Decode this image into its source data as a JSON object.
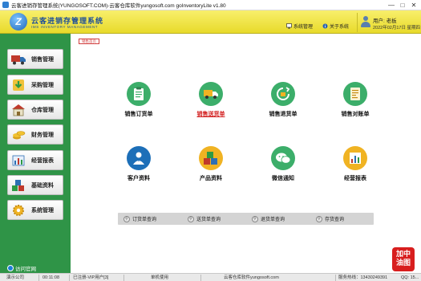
{
  "window": {
    "title": "云客进销存管理系统(YUNGOSOFT.COM)-云客仓库软件yungosoft.com  goInventoryLite v1.80"
  },
  "header": {
    "logo_letter": "Z",
    "logo_cn": "云客进销存管理系统",
    "logo_en": "IMS INVENTORY MANAGEMENT",
    "sys_mgmt": "系统管理",
    "about": "关于系统",
    "user_label": "用户: 老板",
    "datetime": "2022年02月17日 星期四"
  },
  "sidebar": {
    "items": [
      {
        "label": "销售管理",
        "icon": "truck-icon"
      },
      {
        "label": "采购管理",
        "icon": "download-arrow-icon"
      },
      {
        "label": "仓库管理",
        "icon": "warehouse-icon"
      },
      {
        "label": "财务管理",
        "icon": "coins-icon"
      },
      {
        "label": "经营报表",
        "icon": "report-icon"
      },
      {
        "label": "基础资料",
        "icon": "cubes-icon"
      },
      {
        "label": "系统管理",
        "icon": "gear-icon"
      }
    ],
    "visit_site": "访问官网"
  },
  "main": {
    "tab": "销售首页",
    "tiles": [
      {
        "label": "销售订货单",
        "icon": "clipboard-icon",
        "color": "#3cae6a"
      },
      {
        "label": "销售送货单",
        "icon": "delivery-truck-icon",
        "color": "#3cae6a",
        "active": true
      },
      {
        "label": "销售退货单",
        "icon": "return-box-icon",
        "color": "#3cae6a"
      },
      {
        "label": "销售对账单",
        "icon": "statement-icon",
        "color": "#3cae6a"
      },
      {
        "label": "客户资料",
        "icon": "customer-icon",
        "color": "#1d6fb8"
      },
      {
        "label": "产品资料",
        "icon": "product-boxes-icon",
        "color": "#f0b323"
      },
      {
        "label": "微信通知",
        "icon": "wechat-icon",
        "color": "#3cae6a"
      },
      {
        "label": "经营报表",
        "icon": "chart-report-icon",
        "color": "#f0b323"
      }
    ],
    "queries": [
      "订货单查询",
      "送货单查询",
      "退货单查询",
      "存货查询"
    ]
  },
  "status": {
    "company": "演示公司",
    "time": "00:11:08",
    "register": "已注册-VIP用户[3]",
    "mode": "单机使用",
    "product": "云客仓库软件yungosoft.com",
    "service": "服务热线：13430249391",
    "qq": "QQ: 15..."
  },
  "badge": {
    "line1": "加中",
    "line2": "油图"
  },
  "colors": {
    "sidebar": "#2f9447",
    "header": "#f3e84c",
    "accent_red": "#d21d1d"
  }
}
